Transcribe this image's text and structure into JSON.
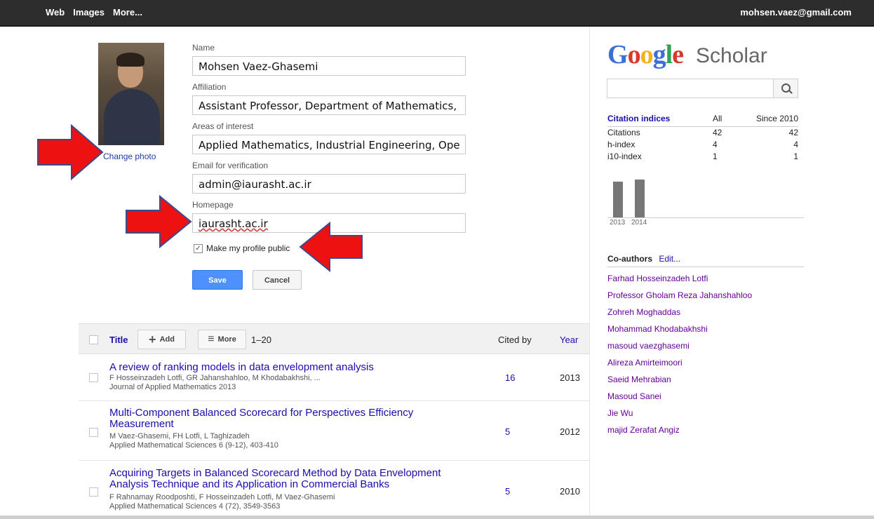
{
  "topbar": {
    "nav": [
      "Web",
      "Images",
      "More..."
    ],
    "user_email": "mohsen.vaez@gmail.com"
  },
  "profile": {
    "change_photo": "Change photo",
    "fields": [
      {
        "label": "Name",
        "value": "Mohsen Vaez-Ghasemi"
      },
      {
        "label": "Affiliation",
        "value": "Assistant Professor, Department of Mathematics,"
      },
      {
        "label": "Areas of interest",
        "value": "Applied Mathematics, Industrial Engineering, Ope"
      },
      {
        "label": "Email for verification",
        "value": "admin@iaurasht.ac.ir"
      },
      {
        "label": "Homepage",
        "value": "iaurasht.ac.ir"
      }
    ],
    "public_checkbox": {
      "label": "Make my profile public",
      "checked": true
    },
    "save_label": "Save",
    "cancel_label": "Cancel"
  },
  "annotations": {
    "arrow_color": "#ee1111",
    "arrow_icon": "red-arrow-icon"
  },
  "table": {
    "title_col": "Title",
    "add_label": "Add",
    "more_label": "More",
    "range": "1–20",
    "cited_col": "Cited by",
    "year_col": "Year",
    "rows": [
      {
        "title": "A review of ranking models in data envelopment analysis",
        "authors": "F Hosseinzadeh Lotfi, GR Jahanshahloo, M Khodabakhshi, ...",
        "journal": "Journal of Applied Mathematics 2013",
        "cited": "16",
        "year": "2013"
      },
      {
        "title": "Multi-Component Balanced Scorecard for Perspectives Efficiency Measurement",
        "authors": "M Vaez-Ghasemi, FH Lotfi, L Taghizadeh",
        "journal": "Applied Mathematical Sciences 6 (9-12), 403-410",
        "cited": "5",
        "year": "2012"
      },
      {
        "title": "Acquiring Targets in Balanced Scorecard Method by Data Envelopment Analysis Technique and its Application in Commercial Banks",
        "authors": "F Rahnamay Roodposhti, F Hosseinzadeh Lotfi, M Vaez-Ghasemi",
        "journal": "Applied Mathematical Sciences 4 (72), 3549-3563",
        "cited": "5",
        "year": "2010"
      }
    ]
  },
  "scholar": {
    "logo_google": "Google",
    "logo_scholar": "Scholar",
    "search_placeholder": "",
    "citation_header": [
      "Citation indices",
      "All",
      "Since 2010"
    ],
    "citation_rows": [
      [
        "Citations",
        "42",
        "42"
      ],
      [
        "h-index",
        "4",
        "4"
      ],
      [
        "i10-index",
        "1",
        "1"
      ]
    ],
    "chart_years": [
      "2013",
      "2014"
    ],
    "chart_values": [
      16,
      17
    ],
    "coauthors_title": "Co-authors",
    "coauthors_edit": "Edit...",
    "coauthors": [
      "Farhad Hosseinzadeh Lotfi",
      "Professor Gholam Reza Jahanshahloo",
      "Zohreh Moghaddas",
      "Mohammad Khodabakhshi",
      "masoud vaezghasemi",
      "Alireza Amirteimoori",
      "Saeid Mehrabian",
      "Masoud Sanei",
      "Jie Wu",
      "majid Zerafat Angiz"
    ]
  }
}
